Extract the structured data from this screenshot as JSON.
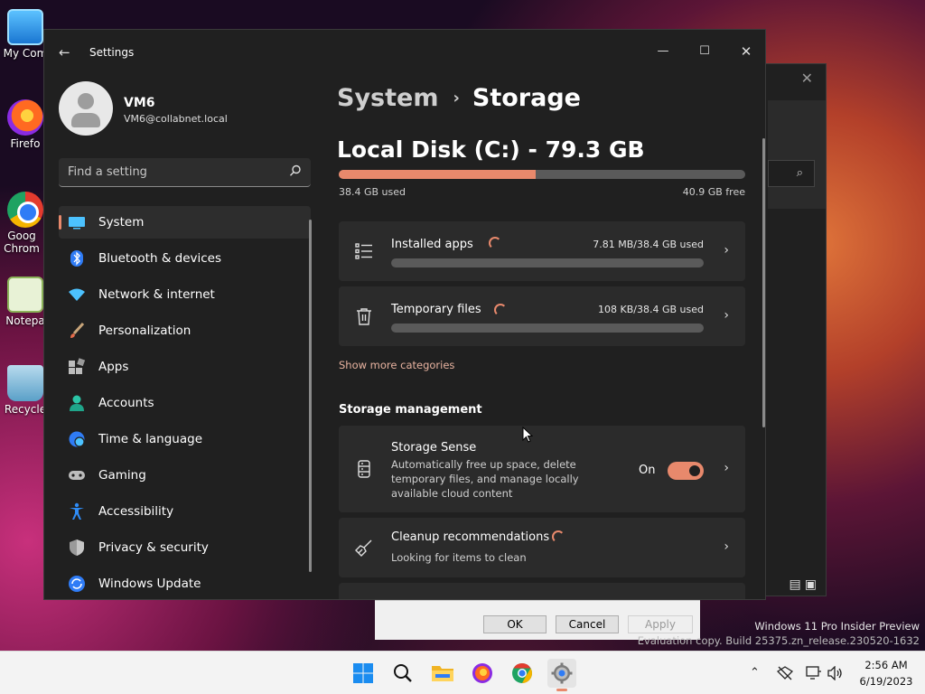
{
  "desktop": {
    "icons": [
      {
        "label": "My Com"
      },
      {
        "label": "Firefo"
      },
      {
        "label": "Goog Chrom"
      },
      {
        "label": "Notepa"
      },
      {
        "label": "Recycle"
      }
    ]
  },
  "background_dialog": {
    "close_symbol": "✕",
    "search_symbol": "⌕",
    "ok_label": "OK",
    "cancel_label": "Cancel",
    "apply_label": "Apply"
  },
  "window": {
    "title": "Settings",
    "controls": {
      "minimize": "—",
      "maximize": "☐",
      "close": "✕"
    }
  },
  "user": {
    "name": "VM6",
    "email": "VM6@collabnet.local"
  },
  "search": {
    "placeholder": "Find a setting"
  },
  "sidebar": {
    "items": [
      {
        "label": "System",
        "icon": "monitor-icon",
        "active": true
      },
      {
        "label": "Bluetooth & devices",
        "icon": "bluetooth-icon"
      },
      {
        "label": "Network & internet",
        "icon": "wifi-icon"
      },
      {
        "label": "Personalization",
        "icon": "brush-icon"
      },
      {
        "label": "Apps",
        "icon": "apps-icon"
      },
      {
        "label": "Accounts",
        "icon": "person-icon"
      },
      {
        "label": "Time & language",
        "icon": "globe-clock-icon"
      },
      {
        "label": "Gaming",
        "icon": "gamepad-icon"
      },
      {
        "label": "Accessibility",
        "icon": "accessibility-icon"
      },
      {
        "label": "Privacy & security",
        "icon": "shield-icon"
      },
      {
        "label": "Windows Update",
        "icon": "update-icon"
      }
    ]
  },
  "breadcrumb": {
    "parent": "System",
    "separator": "›",
    "current": "Storage"
  },
  "disk": {
    "title": "Local Disk (C:) - 79.3 GB",
    "used_label": "38.4 GB used",
    "free_label": "40.9 GB free",
    "used_fraction": 0.484
  },
  "categories": [
    {
      "title": "Installed apps",
      "amount": "7.81 MB/38.4 GB used",
      "icon": "list-icon",
      "fraction": 0.0002
    },
    {
      "title": "Temporary files",
      "amount": "108 KB/38.4 GB used",
      "icon": "trash-icon",
      "fraction": 0.0
    }
  ],
  "show_more": "Show more categories",
  "storage_management": {
    "heading": "Storage management",
    "storage_sense": {
      "title": "Storage Sense",
      "description": "Automatically free up space, delete temporary files, and manage locally available cloud content",
      "toggle_label": "On",
      "toggle_on": true
    },
    "cleanup": {
      "title": "Cleanup recommendations",
      "subtitle": "Looking for items to clean"
    }
  },
  "chevron": "›",
  "taskbar": {
    "time": "2:56 AM",
    "date": "6/19/2023"
  },
  "watermark": {
    "line1": "Windows 11 Pro Insider Preview",
    "line2": "Evaluation copy. Build 25375.zn_release.230520-1632"
  },
  "colors": {
    "accent": "#e8896c",
    "window_bg": "#202020",
    "card_bg": "#2b2b2b"
  }
}
